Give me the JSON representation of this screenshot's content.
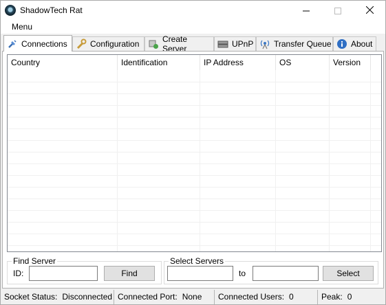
{
  "window": {
    "title": "ShadowTech Rat"
  },
  "menu": {
    "items": [
      "Menu"
    ]
  },
  "tabs": [
    {
      "label": "Connections",
      "icon": "connection-plug-icon",
      "active": true
    },
    {
      "label": "Configuration",
      "icon": "wrench-icon"
    },
    {
      "label": "Create Server",
      "icon": "server-gear-icon"
    },
    {
      "label": "UPnP",
      "icon": "router-icon"
    },
    {
      "label": "Transfer Queue",
      "icon": "antenna-icon"
    },
    {
      "label": "About",
      "icon": "info-icon"
    }
  ],
  "connections": {
    "columns": [
      "Country",
      "Identification",
      "IP Address",
      "OS",
      "Version"
    ],
    "rows": []
  },
  "find_server": {
    "group_label": "Find Server",
    "id_label": "ID:",
    "id_value": "",
    "button_label": "Find"
  },
  "select_servers": {
    "group_label": "Select Servers",
    "from_value": "",
    "to_label": "to",
    "to_value": "",
    "button_label": "Select"
  },
  "status": {
    "socket_label": "Socket Status:",
    "socket_value": "Disconnected",
    "port_label": "Connected Port:",
    "port_value": "None",
    "users_label": "Connected Users:",
    "users_value": "0",
    "peak_label": "Peak:",
    "peak_value": "0"
  }
}
